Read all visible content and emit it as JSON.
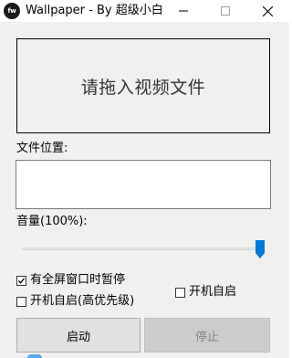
{
  "window": {
    "title": "Wallpaper - By 超级小白",
    "icon_text": "fw",
    "icon": "app-logo-icon",
    "controls": [
      "minimize-icon",
      "maximize-icon",
      "close-icon"
    ]
  },
  "drop_zone": {
    "text": "请拖入视频文件"
  },
  "file_location": {
    "label": "文件位置:",
    "value": ""
  },
  "volume": {
    "label": "音量(100%):",
    "value_percent": 100
  },
  "options": {
    "pause_on_fullscreen": {
      "label": "有全屏窗口时暂停",
      "checked": true
    },
    "autostart": {
      "label": "开机自启",
      "checked": false
    },
    "autostart_high_priority": {
      "label": "开机自启(高优先级)",
      "checked": false
    }
  },
  "buttons": {
    "start": {
      "label": "启动",
      "enabled": true
    },
    "stop": {
      "label": "停止",
      "enabled": false
    }
  },
  "colors": {
    "slider_thumb": "#0078d7",
    "window_bg": "#f0f0f0"
  }
}
